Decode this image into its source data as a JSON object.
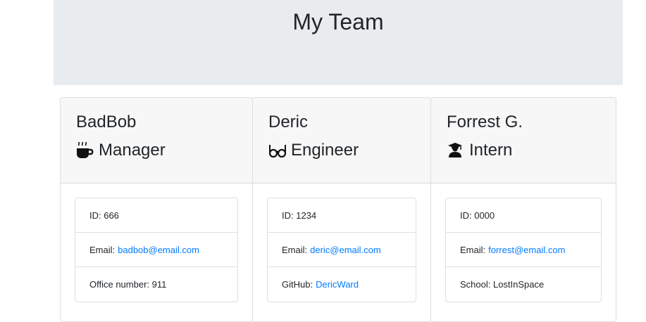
{
  "page": {
    "title": "My Team"
  },
  "colors": {
    "header_bg": "#e9ecef",
    "card_header_bg": "#f7f7f7",
    "link": "#007bff"
  },
  "employees": [
    {
      "name": "BadBob",
      "role": "Manager",
      "role_icon": "mug-hot-icon",
      "id_label": "ID: 666",
      "email_label": "Email:",
      "email": "badbob@email.com",
      "extra_label": "Office number: 911",
      "extra_link": ""
    },
    {
      "name": "Deric",
      "role": "Engineer",
      "role_icon": "glasses-icon",
      "id_label": "ID: 1234",
      "email_label": "Email:",
      "email": "deric@email.com",
      "extra_label": "GitHub:",
      "extra_link": "DericWard"
    },
    {
      "name": "Forrest G.",
      "role": "Intern",
      "role_icon": "graduate-icon",
      "id_label": "ID: 0000",
      "email_label": "Email:",
      "email": "forrest@email.com",
      "extra_label": "School: LostInSpace",
      "extra_link": ""
    }
  ]
}
